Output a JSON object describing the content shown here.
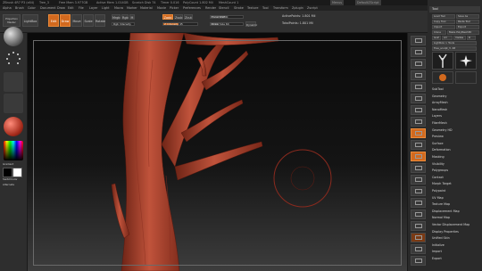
{
  "title_bar": {
    "app": "ZBrush 4R7 P3 (x64)",
    "filename": "Tree_3",
    "mem": "Free Mem 3.977GB",
    "active": "Active Mem 1.014GB",
    "scratch": "Scratch Disk 74",
    "timer": "Timer 0.016",
    "polycount": "PolyCount 1.802 Mil",
    "meshcount": "MeshCount 1"
  },
  "menu_right": {
    "menus": "Menus",
    "default_script": "DefaultZScript"
  },
  "menus": [
    "Alpha",
    "Brush",
    "Color",
    "Document",
    "Draw",
    "Edit",
    "File",
    "Layer",
    "Light",
    "Macro",
    "Marker",
    "Material",
    "Movie",
    "Picker",
    "Preferences",
    "Render",
    "Stencil",
    "Stroke",
    "Texture",
    "Tool",
    "Transform",
    "Zplugin",
    "Zscript"
  ],
  "toolbar": {
    "projection_master": "Projection Master",
    "lightbox": "LightBox",
    "edit": "Edit",
    "draw": "Draw",
    "move": "Move",
    "scale": "Scale",
    "rotate": "Rotate",
    "mrgb": "Mrgb",
    "rgb": "Rgb",
    "m": "M",
    "zadd": "Zadd",
    "zsub": "Zsub",
    "zcut": "Zcut",
    "rgb_intensity": "Rgb Intensity",
    "z_intensity": "Z Intensity 45",
    "focal_shift": "Focal Shift 0",
    "draw_size": "Draw Size 64",
    "dynamic": "Dynamic",
    "active_points": "ActivePoints: 1.801 Mil",
    "total_points": "TotalPoints: 1.801 Mil"
  },
  "tool_palette": {
    "header": "Tool",
    "buttons": [
      "Load Tool",
      "Save As",
      "Copy Tool",
      "Paste Tool",
      "Import",
      "Export",
      "Clone",
      "Make PolyMesh3D",
      "GoZ",
      "All",
      "Visible",
      "R"
    ],
    "lightbox_tools": "Lightbox > Tools",
    "current_tool": "Tree_sculpt_3. 48",
    "thumb_labels": [
      "Tree_sculpt_3",
      "SimpleBrush",
      "Cylinder3D",
      "PM3D_Tree"
    ],
    "subpalettes": [
      "SubTool",
      "Geometry",
      "ArrayMesh",
      "NanoMesh",
      "Layers",
      "FiberMesh",
      "Geometry HD",
      "Preview",
      "Surface",
      "Deformation",
      "Masking",
      "Visibility",
      "Polygroups",
      "Contact",
      "Morph Target",
      "Polypaint",
      "UV Map",
      "Texture Map",
      "Displacement Map",
      "Normal Map",
      "Vector Displacement Map",
      "Display Properties",
      "Unified Skin",
      "Initialize",
      "Import",
      "Export"
    ]
  },
  "left_shelf": {
    "gradient_label": "Gradient",
    "switch_color_label": "SwitchColor",
    "alternate_label": "Alternate"
  },
  "colors": {
    "accent": "#d2691e",
    "sculpt": "#b5432e",
    "canvas_top": "#0a0a0a",
    "canvas_bottom": "#3d3d3d",
    "cursor_ring": "#8a2a1e"
  }
}
